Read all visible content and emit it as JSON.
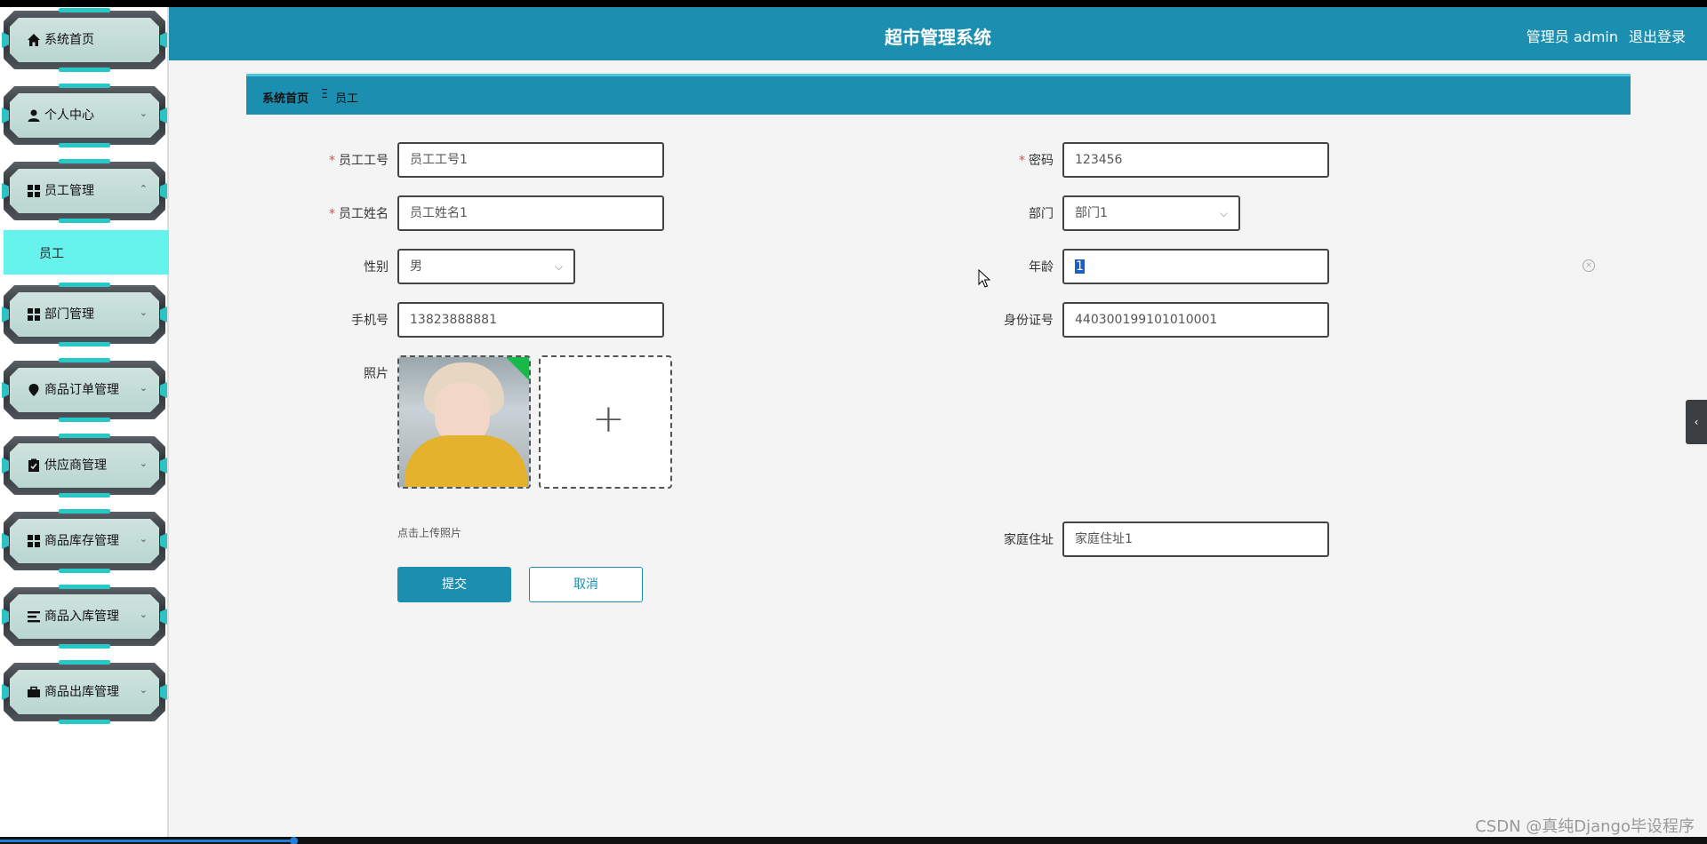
{
  "header": {
    "title": "超市管理系统",
    "user": "管理员 admin",
    "logout": "退出登录"
  },
  "sidebar": {
    "items": [
      {
        "label": "系统首页",
        "icon": "home-icon",
        "arrow": ""
      },
      {
        "label": "个人中心",
        "icon": "user-icon",
        "arrow": "⌄"
      },
      {
        "label": "员工管理",
        "icon": "grid-icon",
        "arrow": "⌃"
      },
      {
        "label": "部门管理",
        "icon": "grid-icon",
        "arrow": "⌄"
      },
      {
        "label": "商品订单管理",
        "icon": "pin-icon",
        "arrow": "⌄"
      },
      {
        "label": "供应商管理",
        "icon": "clipboard-icon",
        "arrow": "⌄"
      },
      {
        "label": "商品库存管理",
        "icon": "grid-icon",
        "arrow": "⌄"
      },
      {
        "label": "商品入库管理",
        "icon": "list-icon",
        "arrow": "⌄"
      },
      {
        "label": "商品出库管理",
        "icon": "briefcase-icon",
        "arrow": "⌄"
      }
    ],
    "submenu": {
      "label": "员工"
    }
  },
  "breadcrumb": {
    "home": "系统首页",
    "separator": "Ξ",
    "current": "员工"
  },
  "form": {
    "employee_no": {
      "label": "员工工号",
      "value": "员工工号1"
    },
    "password": {
      "label": "密码",
      "value": "123456"
    },
    "employee_name": {
      "label": "员工姓名",
      "value": "员工姓名1"
    },
    "department": {
      "label": "部门",
      "value": "部门1"
    },
    "gender": {
      "label": "性别",
      "value": "男"
    },
    "age": {
      "label": "年龄",
      "value": "1"
    },
    "phone": {
      "label": "手机号",
      "value": "13823888881"
    },
    "id_card": {
      "label": "身份证号",
      "value": "440300199101010001"
    },
    "photo": {
      "label": "照片",
      "hint": "点击上传照片",
      "add": "+"
    },
    "address": {
      "label": "家庭住址",
      "value": "家庭住址1"
    },
    "submit": "提交",
    "cancel": "取消",
    "clear": "×"
  },
  "misc": {
    "side_tab": "‹",
    "watermark": "CSDN @真纯Django毕设程序"
  },
  "colors": {
    "primary": "#1c8fb0",
    "active_submenu": "#66f3ee",
    "required": "#e24a4a"
  }
}
